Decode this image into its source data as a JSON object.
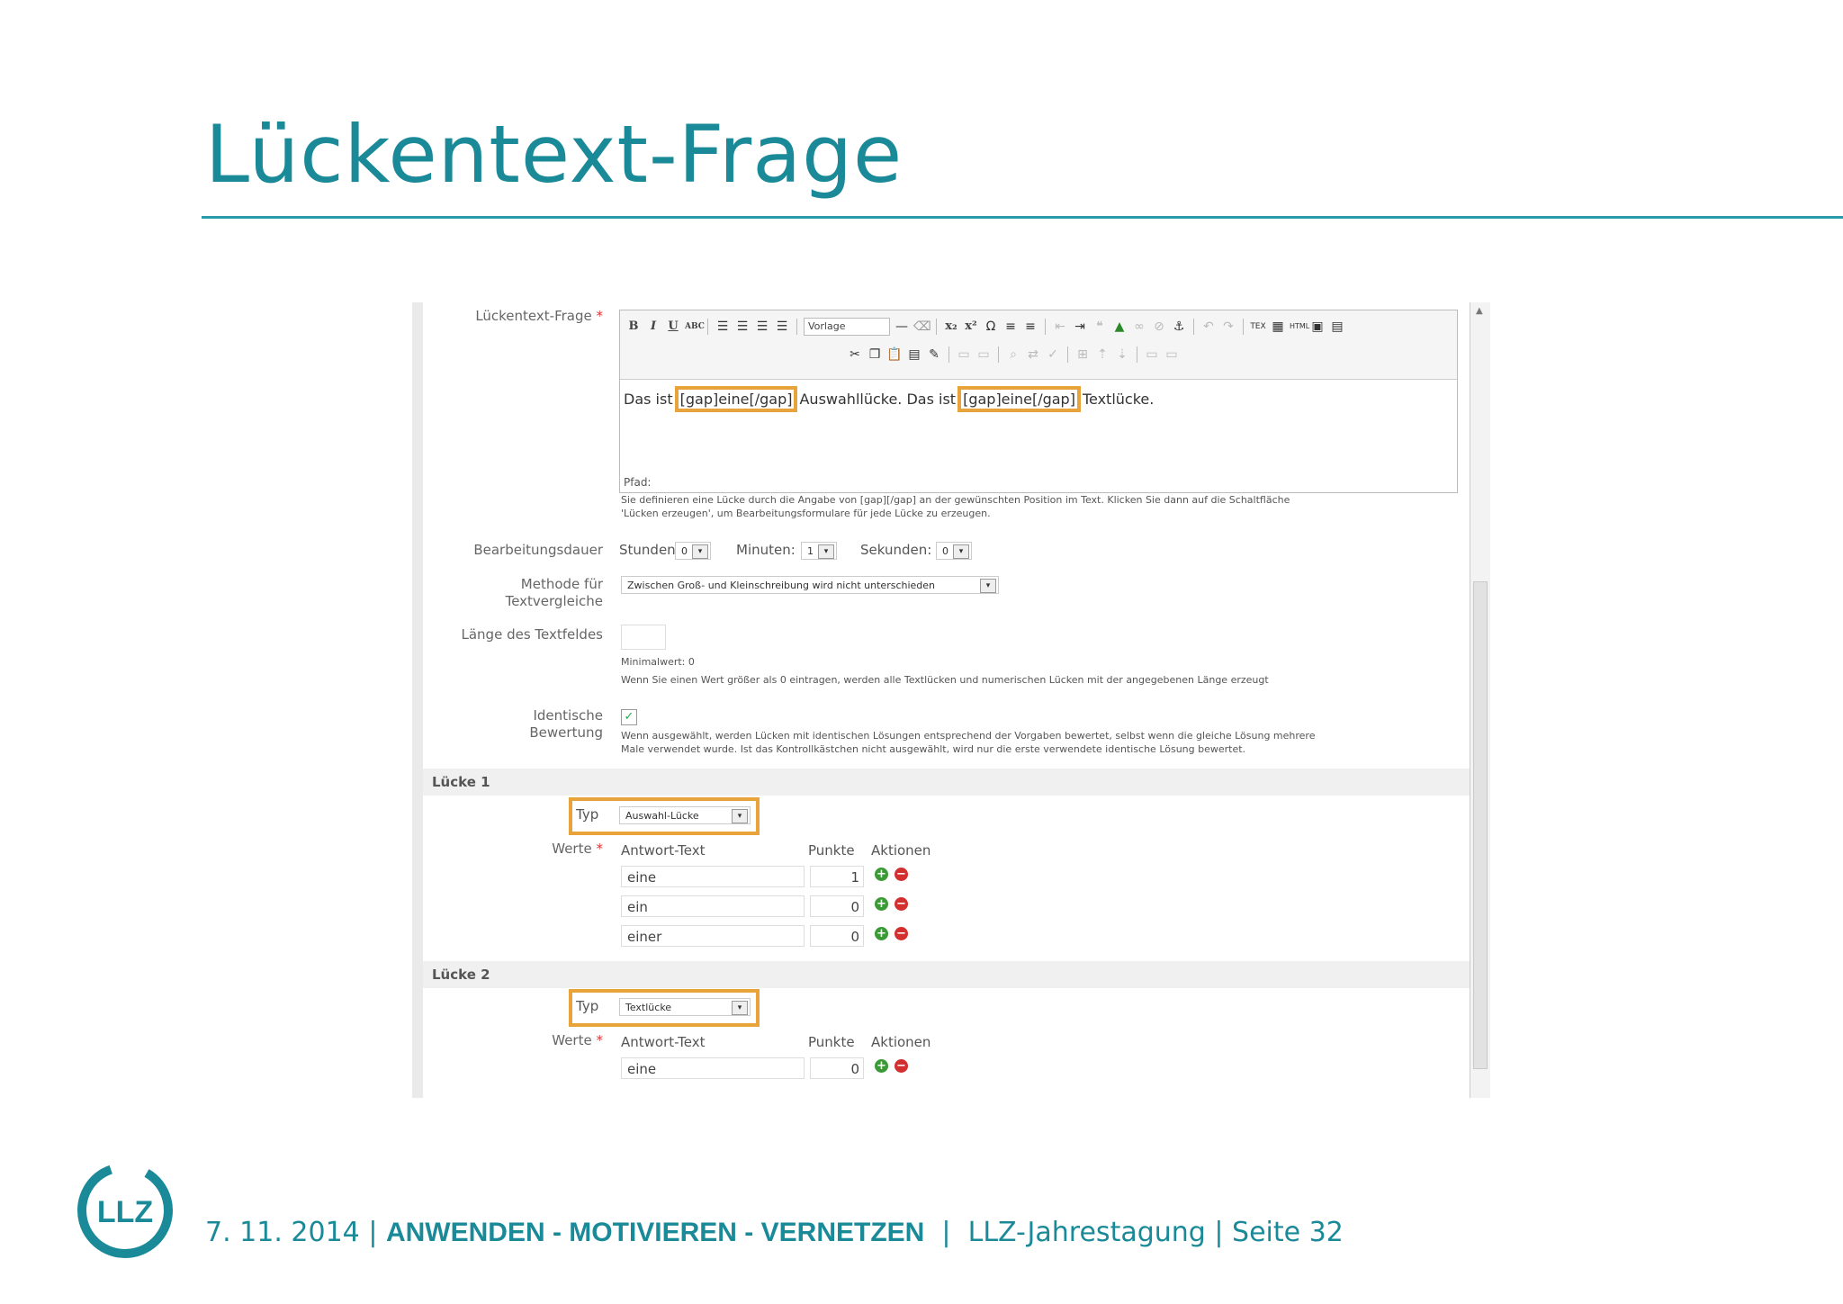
{
  "slide": {
    "title": "Lückentext-Frage",
    "footer": {
      "date": "7. 11. 2014",
      "slogan": "ANWENDEN - MOTIVIEREN - VERNETZEN",
      "event": "LLZ-Jahrestagung",
      "page_label": "Seite",
      "page_number": "32",
      "logo_text": "LLZ"
    }
  },
  "form": {
    "question_label": "Lückentext-Frage",
    "required_mark": "*",
    "toolbar": {
      "format_select": "Vorlage"
    },
    "editor": {
      "text_before": "Das ist",
      "gap1": "[gap]eine[/gap]",
      "text_middle": "Auswahllücke. Das ist",
      "gap2": "[gap]eine[/gap]",
      "text_after": "Textlücke.",
      "path_label": "Pfad:"
    },
    "editor_hint_line1": "Sie definieren eine Lücke durch die Angabe von [gap][/gap] an der gewünschten Position im Text. Klicken Sie dann auf die Schaltfläche",
    "editor_hint_line2": "'Lücken erzeugen', um Bearbeitungsformulare für jede Lücke zu erzeugen.",
    "duration": {
      "label": "Bearbeitungsdauer",
      "hours_label": "Stunden:",
      "hours_value": "0",
      "minutes_label": "Minuten:",
      "minutes_value": "1",
      "seconds_label": "Sekunden:",
      "seconds_value": "0"
    },
    "method": {
      "label_line1": "Methode für",
      "label_line2": "Textvergleiche",
      "value": "Zwischen Groß- und Kleinschreibung wird nicht unterschieden"
    },
    "textfield_length": {
      "label": "Länge des Textfeldes",
      "value": "",
      "min_hint": "Minimalwert: 0",
      "hint": "Wenn Sie einen Wert größer als 0 eintragen, werden alle Textlücken und numerischen Lücken mit der angegebenen Länge erzeugt"
    },
    "identical_scoring": {
      "label_line1": "Identische",
      "label_line2": "Bewertung",
      "checked_mark": "✓",
      "hint_line1": "Wenn ausgewählt, werden Lücken mit identischen Lösungen entsprechend der Vorgaben bewertet, selbst wenn die gleiche Lösung mehrere",
      "hint_line2": "Male verwendet wurde. Ist das Kontrollkästchen nicht ausgewählt, wird nur die erste verwendete identische Lösung bewertet."
    }
  },
  "gaps": [
    {
      "title": "Lücke 1",
      "type_label": "Typ",
      "type_value": "Auswahl-Lücke",
      "values_label": "Werte",
      "col_answer": "Antwort-Text",
      "col_points": "Punkte",
      "col_actions": "Aktionen",
      "rows": [
        {
          "answer": "eine",
          "points": "1"
        },
        {
          "answer": "ein",
          "points": "0"
        },
        {
          "answer": "einer",
          "points": "0"
        }
      ]
    },
    {
      "title": "Lücke 2",
      "type_label": "Typ",
      "type_value": "Textlücke",
      "values_label": "Werte",
      "col_answer": "Antwort-Text",
      "col_points": "Punkte",
      "col_actions": "Aktionen",
      "rows": [
        {
          "answer": "eine",
          "points": "0"
        }
      ]
    }
  ],
  "icons": {
    "add": "+",
    "remove": "−",
    "caret": "▾"
  },
  "colors": {
    "brand": "#1a8a99",
    "highlight": "#e8a33a"
  }
}
